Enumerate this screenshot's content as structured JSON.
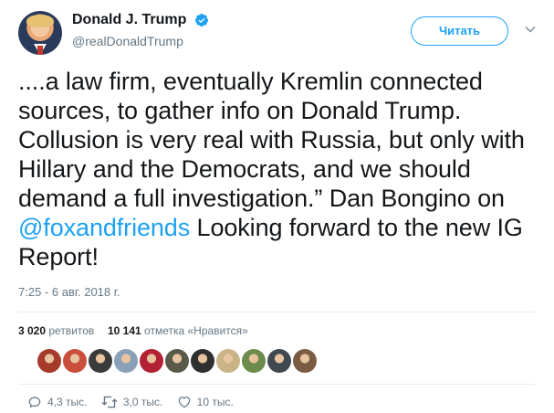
{
  "author": {
    "display_name": "Donald J. Trump",
    "handle": "@realDonaldTrump",
    "verified": true
  },
  "follow_button": {
    "label": "Читать"
  },
  "tweet": {
    "text_before": "....a law firm, eventually Kremlin connected sources, to gather info on Donald Trump. Collusion is very real with Russia, but only with Hillary and the Democrats, and we should demand a full investigation.” Dan Bongino on ",
    "mention": "@foxandfriends",
    "text_after": "  Looking forward to the new IG Report!"
  },
  "timestamp": "7:25 - 6 авг. 2018 г.",
  "stats": {
    "retweets_count": "3 020",
    "retweets_label": "ретвитов",
    "likes_count": "10 141",
    "likes_label": "отметка «Нравится»"
  },
  "likers": [
    {
      "name": "liker-avatar-1",
      "color": "#a63a2b"
    },
    {
      "name": "liker-avatar-2",
      "color": "#c94f3c"
    },
    {
      "name": "liker-avatar-3",
      "color": "#3b3b3b"
    },
    {
      "name": "liker-avatar-4",
      "color": "#8aa0b8"
    },
    {
      "name": "liker-avatar-5",
      "color": "#b22234"
    },
    {
      "name": "liker-avatar-6",
      "color": "#5a5a4a"
    },
    {
      "name": "liker-avatar-7",
      "color": "#2f2f2f"
    },
    {
      "name": "liker-avatar-8",
      "color": "#c9b487"
    },
    {
      "name": "liker-avatar-9",
      "color": "#6d8b4a"
    },
    {
      "name": "liker-avatar-10",
      "color": "#404850"
    },
    {
      "name": "liker-avatar-11",
      "color": "#7a5c45"
    }
  ],
  "actions": {
    "replies": "4,3 тыс.",
    "retweets": "3,0 тыс.",
    "likes": "10 тыс."
  },
  "colors": {
    "accent": "#1da1f2",
    "text": "#14171a",
    "secondary_text": "#657786",
    "divider": "#e6ecf0"
  }
}
